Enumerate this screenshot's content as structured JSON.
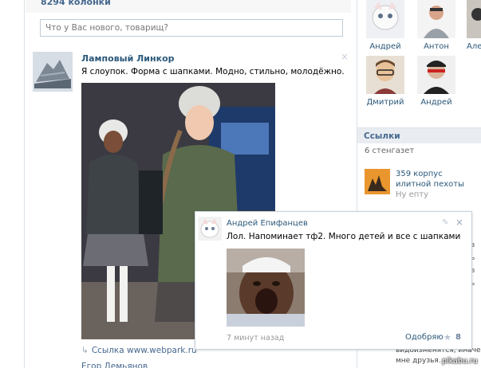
{
  "wall": {
    "count": "8294 колонки",
    "status_placeholder": "Что у Вас нового, товарищ?"
  },
  "post": {
    "author": "Ламповый Линкор",
    "text": "Я слоупок. Форма с шапками. Модно, стильно, молодёжно.",
    "link": "Ссылка www.webpark.ru",
    "next_author": "Егор Демьянов",
    "close_icon": "×"
  },
  "friends": [
    {
      "name": "Андрей"
    },
    {
      "name": "Антон"
    },
    {
      "name": "Але"
    },
    {
      "name": "Дмитрий"
    },
    {
      "name": "Андрей"
    }
  ],
  "links": {
    "header": "Ссылки",
    "count": "6 стенгазет",
    "item_title": "359 корпус илитной пехоты",
    "item_sub": "Ну епту"
  },
  "comment": {
    "author": "Андрей Епифанцев",
    "text": "Лол. Напоминает тф2. Много детей и все с шапками",
    "time": "7 минут назад",
    "like_label": "Одобряю",
    "like_count": "8",
    "edit_icon": "✎",
    "close_icon": "×",
    "star_icon": "★"
  },
  "background_text": {
    "line1": "видоизменятся, иначе",
    "line2": "мне друзья."
  },
  "side_fragments": [
    "в",
    "ь",
    "в",
    "ь"
  ],
  "watermark": "pikabu.ru",
  "colors": {
    "link": "#2b587a",
    "accent": "#45688e",
    "border": "#dae1e8"
  }
}
